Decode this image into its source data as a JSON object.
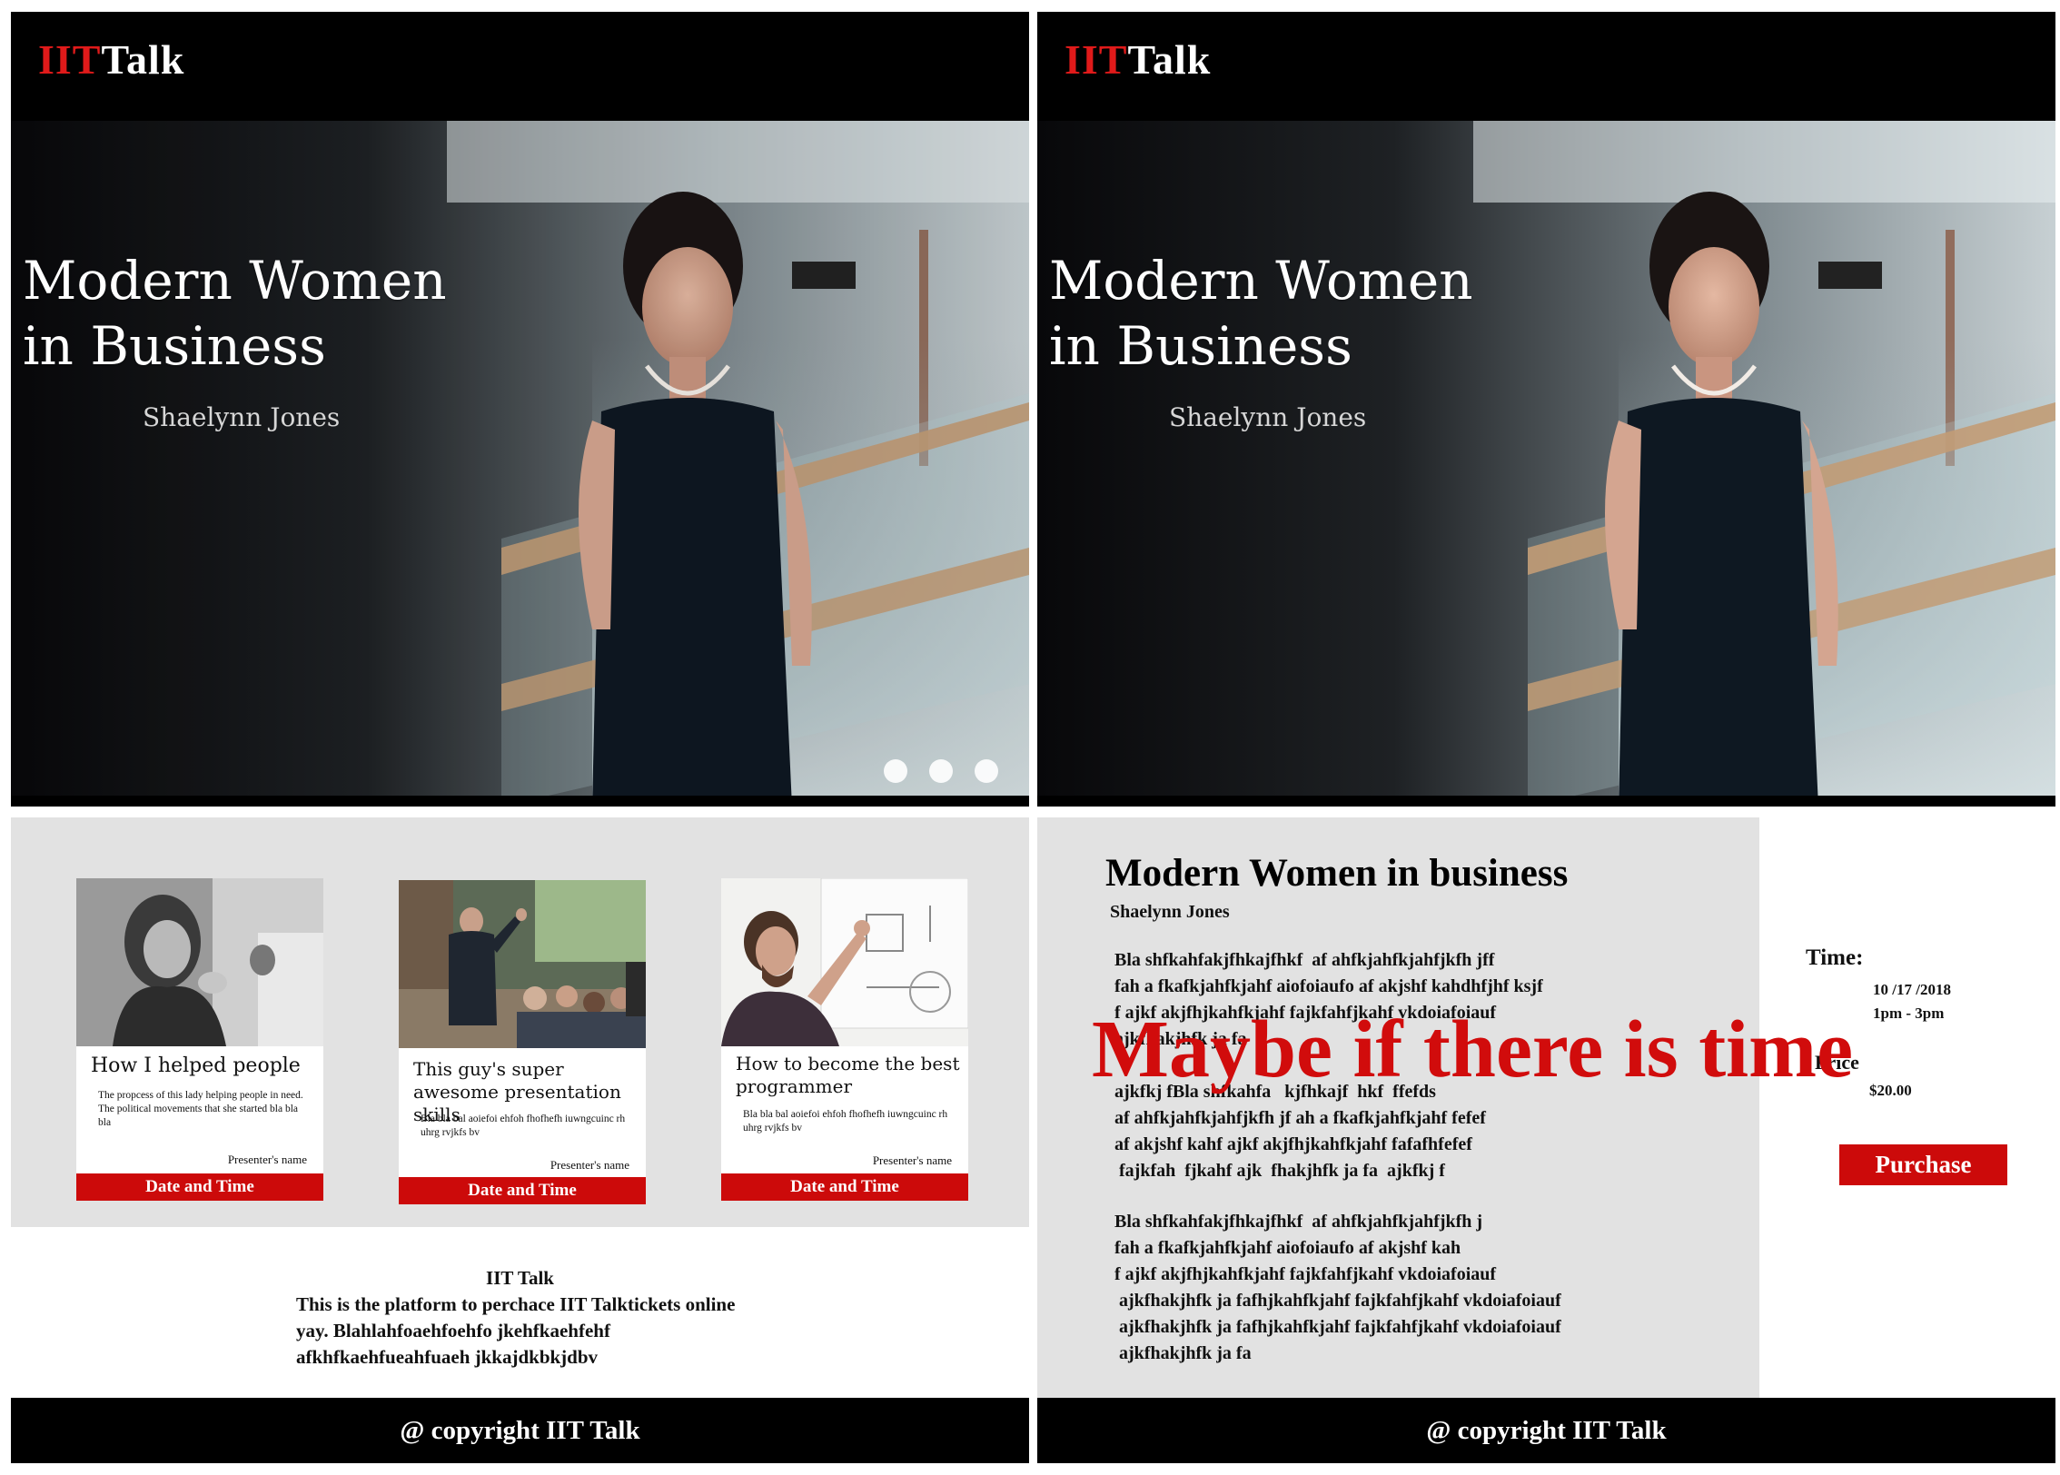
{
  "brand": {
    "logo_red": "IIT",
    "logo_white": "Talk"
  },
  "hero": {
    "title_line1": "Modern Women",
    "title_line2": "in Business",
    "speaker": "Shaelynn Jones",
    "slide_count": 3
  },
  "cards": [
    {
      "title": "How I helped people",
      "description": "The propcess of this lady helping people in need. The political movements that she started bla bla bla",
      "presenter": "Presenter's name",
      "date_label": "Date and Time",
      "photo": "woman-in-hijab-clapping"
    },
    {
      "title": "This guy's super awesome presentation skills",
      "description": "Bla bla bal aoiefoi ehfoh fhofhefh iuwngcuinc rh uhrg rvjkfs bv",
      "presenter": "Presenter's name",
      "date_label": "Date and Time",
      "photo": "man-presenting-to-audience"
    },
    {
      "title": "How to become the best programmer",
      "description": "Bla bla bal aoiefoi ehfoh fhofhefh iuwngcuinc rh uhrg rvjkfs bv",
      "presenter": "Presenter's name",
      "date_label": "Date and Time",
      "photo": "man-drawing-on-whiteboard"
    }
  ],
  "about": {
    "title": "IIT Talk",
    "body": "This is the platform to perchace IIT Talktickets online yay. Blahlahfoaehfoehfo jkehfkaehfehf afkhfkaehfueahfuaeh jkkajdkbkjdbv"
  },
  "footer": {
    "copyright": "@ copyright IIT Talk"
  },
  "detail": {
    "title": "Modern Women in business",
    "presenter": "Shaelynn Jones",
    "paragraph_1": [
      "Bla shfkahfakjfhkajfhkf  af ahfkjahfkjahfjkfh jff",
      "fah a fkafkjahfkjahf aiofoiaufo af akjshf kahdhfjhf ksjf",
      "f ajkf akjfhjkahfkjahf fajkfahfjkahf vkdoiafoiauf",
      "ajkfhakjhfk ja fa",
      "",
      "ajkfkj fBla shfkahfa   kjfhkajf  hkf  ffefds",
      "af ahfkjahfkjahfjkfh jf ah a fkafkjahfkjahf fefef",
      "af akjshf kahf ajkf akjfhjkahfkjahf fafafhfefef",
      " fajkfah  fjkahf ajk  fhakjhfk ja fa  ajkfkj f"
    ],
    "paragraph_2": [
      "Bla shfkahfakjfhkajfhkf  af ahfkjahfkjahfjkfh j",
      "fah a fkafkjahfkjahf aiofoiaufo af akjshf kah",
      "f ajkf akjfhjkahfkjahf fajkfahfjkahf vkdoiafoiauf",
      " ajkfhakjhfk ja fafhjkahfkjahf fajkfahfjkahf vkdoiafoiauf",
      " ajkfhakjhfk ja fafhjkahfkjahf fajkfahfjkahf vkdoiafoiauf",
      " ajkfhakjhfk ja fa"
    ],
    "time_label": "Time:",
    "date": "10 /17 /2018",
    "time_range": "1pm - 3pm",
    "price_label": "Price",
    "price": "$20.00",
    "purchase_label": "Purchase",
    "overlay_note": "Maybe if there is time"
  },
  "colors": {
    "accent_red": "#cc0a0a",
    "logo_red": "#e01a1a",
    "band_gray": "#e2e2e2"
  }
}
